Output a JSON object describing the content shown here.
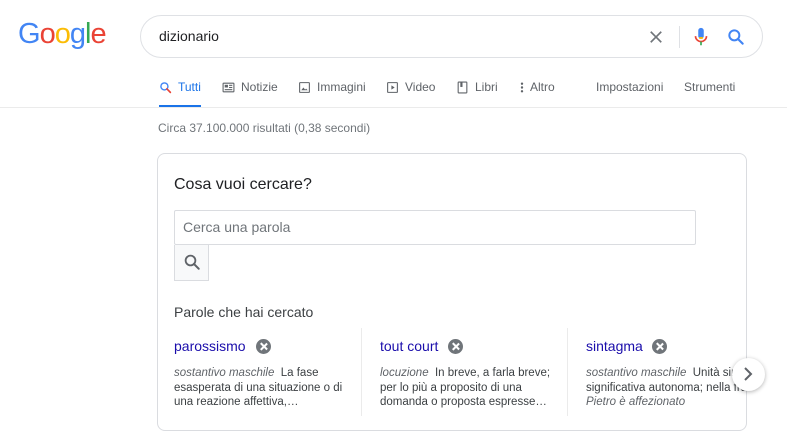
{
  "logo": {
    "letters": [
      "G",
      "o",
      "o",
      "g",
      "l",
      "e"
    ],
    "colors": [
      "#4285F4",
      "#EA4335",
      "#FBBC05",
      "#4285F4",
      "#34A853",
      "#EA4335"
    ]
  },
  "search": {
    "query": "dizionario"
  },
  "icons": {
    "clear": "close-icon",
    "mic": "microphone-icon",
    "search": "search-icon"
  },
  "tabs": [
    {
      "label": "Tutti",
      "icon": "search-icon",
      "active": true
    },
    {
      "label": "Notizie",
      "icon": "news-icon"
    },
    {
      "label": "Immagini",
      "icon": "image-icon"
    },
    {
      "label": "Video",
      "icon": "video-icon"
    },
    {
      "label": "Libri",
      "icon": "book-icon"
    },
    {
      "label": "Altro",
      "icon": "more-icon"
    }
  ],
  "tools": {
    "settings": "Impostazioni",
    "tools": "Strumenti"
  },
  "result_stats": "Circa 37.100.000 risultati (0,38 secondi)",
  "dictionary": {
    "title": "Cosa vuoi cercare?",
    "input_placeholder": "Cerca una parola",
    "history_label": "Parole che hai cercato",
    "recent": [
      {
        "word": "parossismo",
        "pos": "sostantivo maschile",
        "def": "La fase esasperata di una situazione o di una reazione affettiva,…"
      },
      {
        "word": "tout court",
        "pos": "locuzione",
        "def": "In breve, a farla breve; per lo più a proposito di una domanda o proposta espresse…"
      },
      {
        "word": "sintagma",
        "pos": "sostantivo maschile",
        "def": "Unità sintattica significativa autonoma; nella frase",
        "def_example": "Pietro è affezionato"
      }
    ]
  },
  "accent_color": "#1a73e8",
  "link_color": "#1a0dab"
}
